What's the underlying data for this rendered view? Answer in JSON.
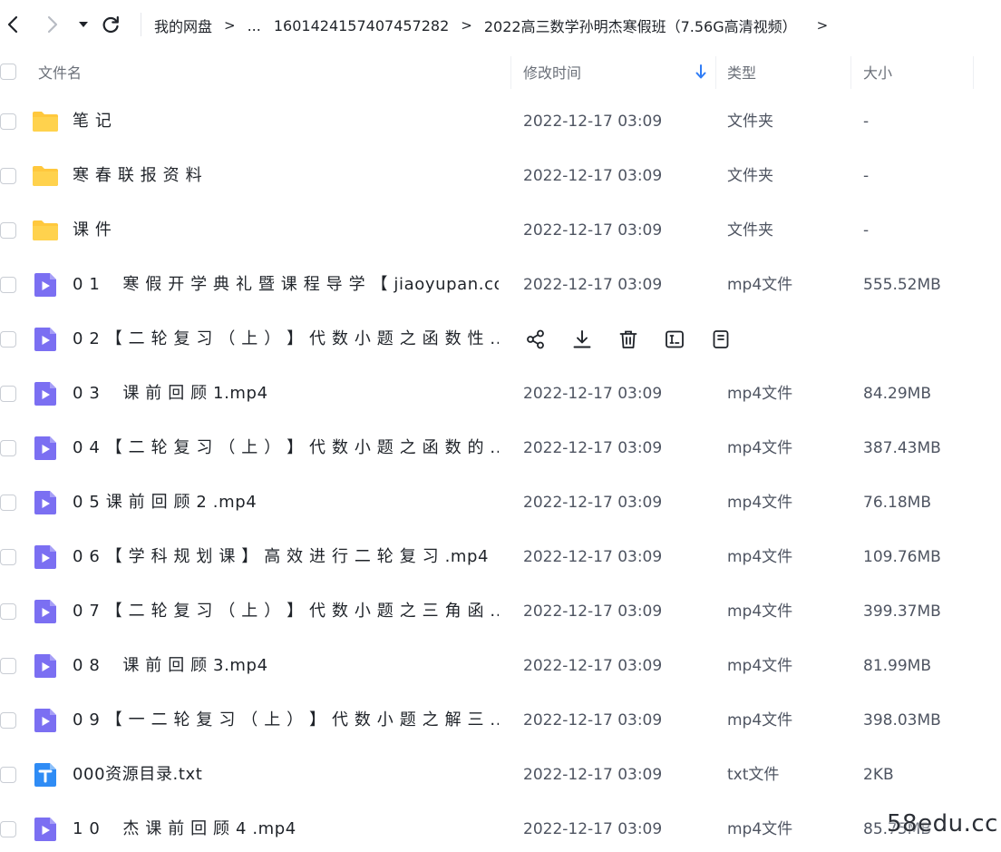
{
  "nav": {
    "breadcrumb": [
      "我的网盘",
      "...",
      "1601424157407457282",
      "2022高三数学孙明杰寒假班（7.56G高清视频）"
    ],
    "separator": ">"
  },
  "table": {
    "columns": {
      "name": "文件名",
      "mtime": "修改时间",
      "type": "类型",
      "size": "大小"
    },
    "sort": "修改时间 descending",
    "rows": [
      {
        "icon": "folder-icon",
        "name": "笔 记",
        "mtime": "2022-12-17 03:09",
        "type": "文件夹",
        "size": "-"
      },
      {
        "icon": "folder-icon",
        "name": "寒 春 联 报 资 料",
        "mtime": "2022-12-17 03:09",
        "type": "文件夹",
        "size": "-"
      },
      {
        "icon": "folder-icon",
        "name": "课 件",
        "mtime": "2022-12-17 03:09",
        "type": "文件夹",
        "size": "-"
      },
      {
        "icon": "video-file-icon",
        "name": "0 1 　寒 假 开 学 典 礼 暨 课 程 导 学 【 jiaoyupan.co...",
        "mtime": "2022-12-17 03:09",
        "type": "mp4文件",
        "size": "555.52MB"
      },
      {
        "icon": "video-file-icon",
        "name": "0 2 【 二 轮 复 习 （ 上 ） 】 代 数 小 题 之 函 数 性 ...",
        "hovered": true
      },
      {
        "icon": "video-file-icon",
        "name": "0 3 　课 前 回 顾 1.mp4",
        "mtime": "2022-12-17 03:09",
        "type": "mp4文件",
        "size": "84.29MB"
      },
      {
        "icon": "video-file-icon",
        "name": "0 4 【 二 轮 复 习 （ 上 ） 】 代 数 小 题 之 函 数 的 ...",
        "mtime": "2022-12-17 03:09",
        "type": "mp4文件",
        "size": "387.43MB"
      },
      {
        "icon": "video-file-icon",
        "name": "0 5 课 前 回 顾 2 .mp4",
        "mtime": "2022-12-17 03:09",
        "type": "mp4文件",
        "size": "76.18MB"
      },
      {
        "icon": "video-file-icon",
        "name": "0 6 【 学 科 规 划 课 】 高 效 进 行 二 轮 复 习 .mp4",
        "mtime": "2022-12-17 03:09",
        "type": "mp4文件",
        "size": "109.76MB"
      },
      {
        "icon": "video-file-icon",
        "name": "0 7 【 二 轮 复 习 （ 上 ） 】 代 数 小 题 之 三 角 函 ...",
        "mtime": "2022-12-17 03:09",
        "type": "mp4文件",
        "size": "399.37MB"
      },
      {
        "icon": "video-file-icon",
        "name": "0 8 　课 前 回 顾 3.mp4",
        "mtime": "2022-12-17 03:09",
        "type": "mp4文件",
        "size": "81.99MB"
      },
      {
        "icon": "video-file-icon",
        "name": "0 9 【 一 二 轮 复 习 （ 上 ） 】 代 数 小 题 之 解 三 ...",
        "mtime": "2022-12-17 03:09",
        "type": "mp4文件",
        "size": "398.03MB"
      },
      {
        "icon": "text-file-icon",
        "name": "000资源目录.txt",
        "mtime": "2022-12-17 03:09",
        "type": "txt文件",
        "size": "2KB"
      },
      {
        "icon": "video-file-icon",
        "name": "1 0 　杰 课 前 回 顾 4 .mp4",
        "mtime": "2022-12-17 03:09",
        "type": "mp4文件",
        "size": "85.75MB"
      }
    ],
    "hover_actions": [
      "share-icon",
      "download-icon",
      "delete-icon",
      "rename-icon",
      "more-icon"
    ]
  },
  "colors": {
    "accent": "#2f7cf6",
    "folder": "#ffc83d",
    "video": "#7b6ff2",
    "text_file": "#2f8cf5"
  },
  "watermark": "58edu.cc"
}
